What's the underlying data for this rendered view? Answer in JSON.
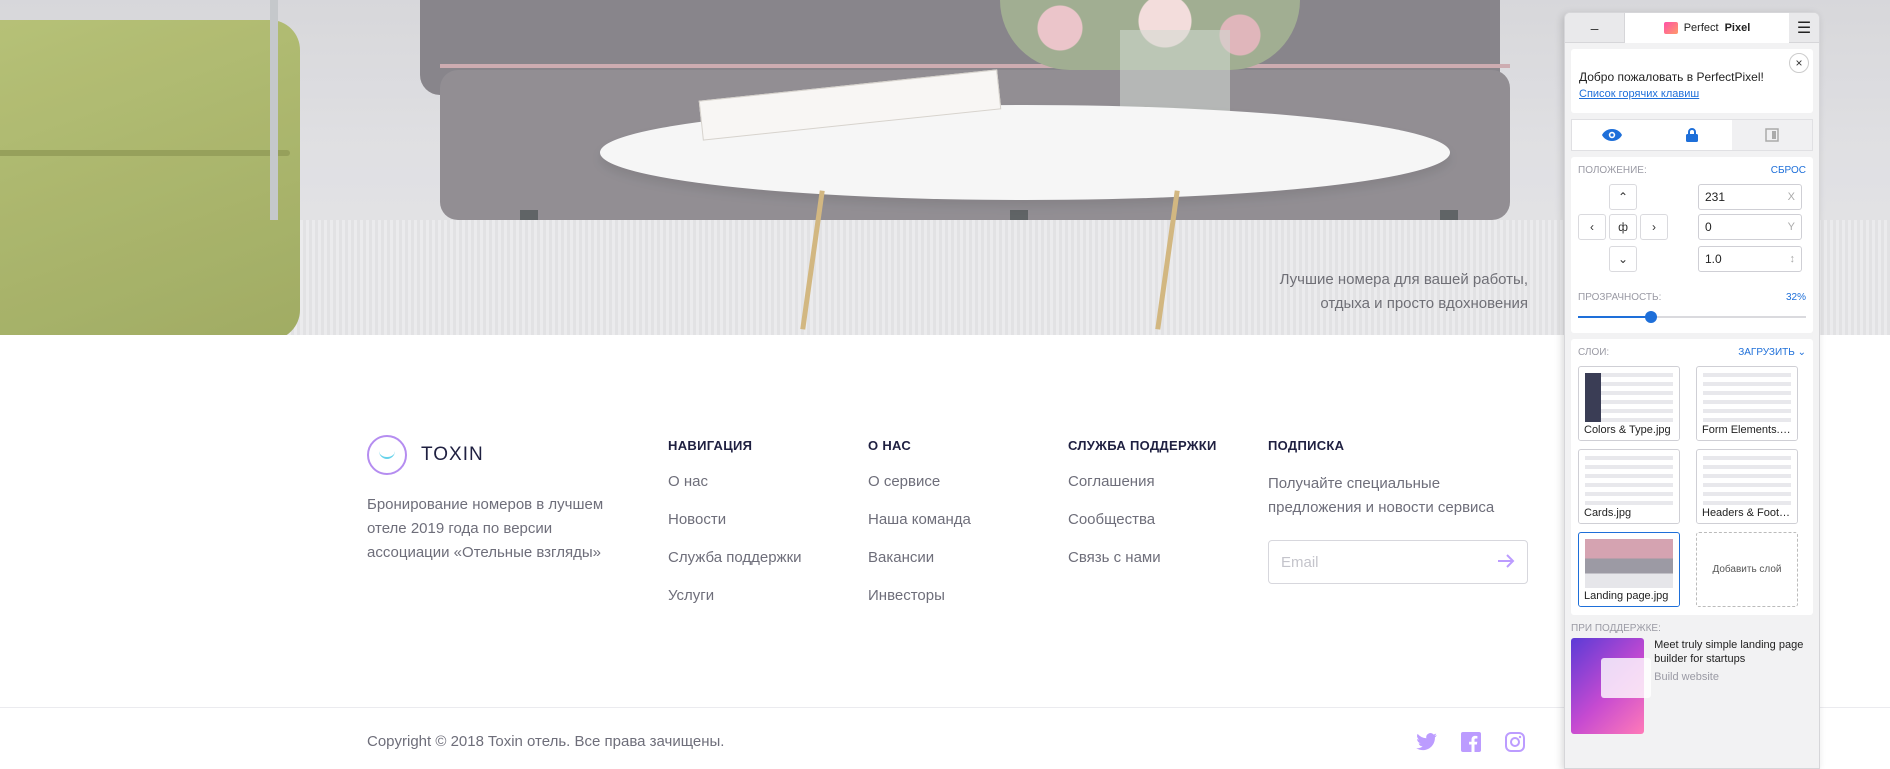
{
  "hero": {
    "tagline_line1": "Лучшие номера для вашей работы,",
    "tagline_line2": "отдыха и просто вдохновения"
  },
  "footer": {
    "brand": "TOXIN",
    "about": "Бронирование номеров в лучшем отеле 2019 года по версии ассоциации «Отельные взгляды»",
    "columns": [
      {
        "title": "НАВИГАЦИЯ",
        "links": [
          "О нас",
          "Новости",
          "Служба поддержки",
          "Услуги"
        ]
      },
      {
        "title": "О НАС",
        "links": [
          "О сервисе",
          "Наша команда",
          "Вакансии",
          "Инвесторы"
        ]
      },
      {
        "title": "СЛУЖБА ПОДДЕРЖКИ",
        "links": [
          "Соглашения",
          "Сообщества",
          "Связь с нами"
        ]
      }
    ],
    "subscribe": {
      "title": "ПОДПИСКА",
      "text": "Получайте специальные предложения и новости сервиса",
      "email_placeholder": "Email",
      "arrow_icon": "arrow-right-icon"
    },
    "copyright": "Copyright © 2018 Toxin отель. Все права зачищены.",
    "socials": [
      "twitter-icon",
      "facebook-icon",
      "instagram-icon"
    ],
    "accent_color": "#BC9CFF"
  },
  "perfectpixel": {
    "minimize": "–",
    "title_prefix": "Perfect",
    "title_bold": "Pixel",
    "welcome": "Добро пожаловать в PerfectPixel!",
    "hotkeys_link": "Список горячих клавиш",
    "close": "×",
    "position_label": "ПОЛОЖЕНИЕ:",
    "reset_label": "СБРОС",
    "x_value": "231",
    "x_unit": "X",
    "y_value": "0",
    "y_unit": "Y",
    "scale_value": "1.0",
    "scale_unit": "↕",
    "center_glyph": "ф",
    "opacity_label": "ПРОЗРАЧНОСТЬ:",
    "opacity_value": "32%",
    "opacity_fraction": 0.32,
    "layers_label": "СЛОИ:",
    "upload_label": "ЗАГРУЗИТЬ",
    "layers": [
      "Colors & Type.jpg",
      "Form Elements.jpg",
      "Cards.jpg",
      "Headers & Footers.jpg",
      "Landing page.jpg"
    ],
    "add_layer": "Добавить слой",
    "sponsor_label": "ПРИ ПОДДЕРЖКЕ:",
    "ad_text": "Meet truly simple landing page builder for startups",
    "ad_cta": "Build website",
    "accent_color": "#1E6FD9"
  }
}
